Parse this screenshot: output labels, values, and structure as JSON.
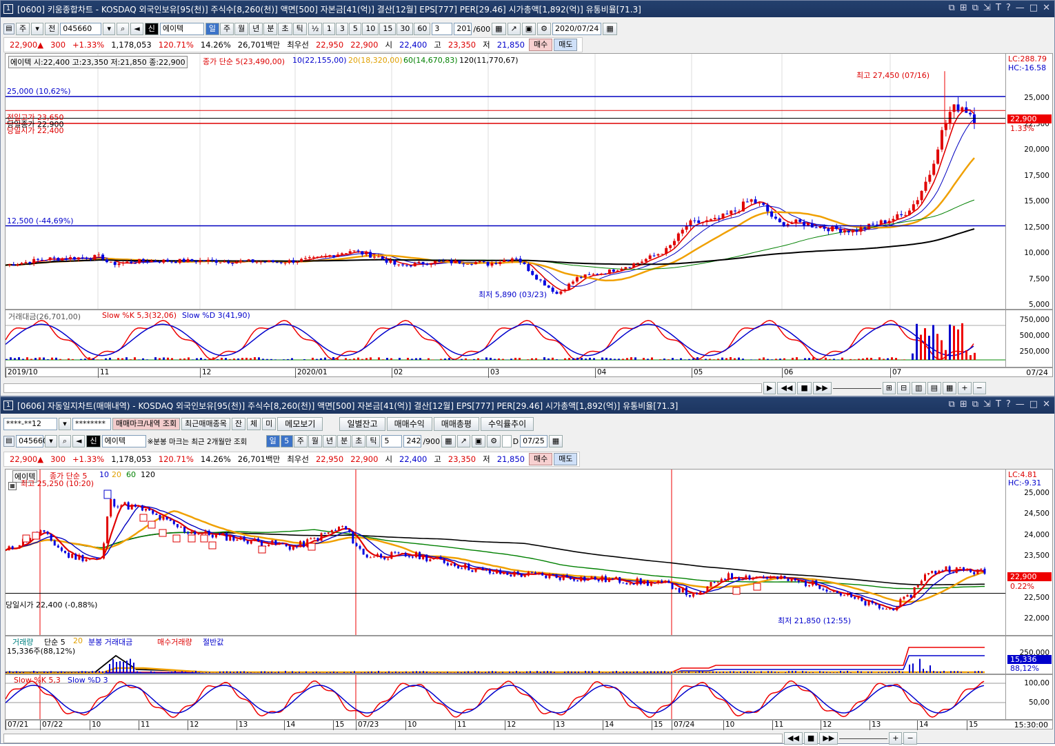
{
  "top": {
    "title": "[0600] 키움종합차트 - KOSDAQ 외국인보유[95(천)] 주식수[8,260(천)] 액면[500] 자본금[41(억)] 결산[12월] EPS[777] PER[29.46] 시가총액[1,892(억)] 유통비율[71.3]",
    "win_num": "1",
    "toolbar": {
      "code": "045660",
      "name": "에이텍",
      "period_tabs": [
        "일",
        "주",
        "월",
        "년",
        "분",
        "초",
        "틱"
      ],
      "halves": [
        "½",
        "1",
        "3",
        "5",
        "10",
        "15",
        "30",
        "60"
      ],
      "count": "3",
      "range": "201",
      "range_max": "/600",
      "date": "2020/07/24",
      "btn_ju": "주",
      "btn_jeon": "전",
      "btn_sin": "신"
    },
    "quote": {
      "price": "22,900▲",
      "change": "300",
      "rate": "+1.33%",
      "volume": "1,178,053",
      "vol_ratio": "120.71%",
      "turnover": "14.26%",
      "amount": "26,701백만",
      "best_label": "최우선",
      "best_ask": "22,950",
      "best_bid": "22,900",
      "open_label": "시",
      "open": "22,400",
      "high_label": "고",
      "high": "23,350",
      "low_label": "저",
      "low": "21,850",
      "buy": "매수",
      "sell": "매도"
    },
    "legend": {
      "ohlc": "에이텍 시:22,400 고:23,350 저:21,850 종:22,900",
      "ma_title": "종가 단순 5(23,490,00)",
      "ma10": "10(22,155,00)",
      "ma20": "20(18,320,00)",
      "ma60": "60(14,670,83)",
      "ma120": "120(11,770,67)"
    },
    "hlines": {
      "l25000": "25,000 (10,62%)",
      "l12500": "12,500 (-44,69%)",
      "prev_high": "전일고가 23,650",
      "today_close": "당일종가 22,900",
      "today_open": "당일시가 22,400"
    },
    "annotations": {
      "high": "최고 27,450 (07/16)",
      "low": "최저 5,890 (03/23)"
    },
    "lc": "LC:288.79",
    "hc": "HC:-16.58",
    "cur_price": "22,900",
    "cur_rate": "1.33%",
    "yticks": [
      "25,000",
      "22,500",
      "20,000",
      "17,500",
      "15,000",
      "12,500",
      "10,000",
      "7,500",
      "5,000"
    ],
    "sub_legend": {
      "amount": "거래대금(26,701,00)",
      "k": "Slow %K 5,3(32,06)",
      "d": "Slow %D 3(41,90)"
    },
    "sub_yticks": [
      "750,000",
      "500,000",
      "250,000"
    ],
    "xticks": [
      "2019/10",
      "11",
      "12",
      "2020/01",
      "02",
      "03",
      "04",
      "05",
      "06",
      "07"
    ],
    "x_end": "07/24"
  },
  "bottom": {
    "title": "[0606] 자동일지차트(매매내역) - KOSDAQ 외국인보유[95(천)] 주식수[8,260(천)] 액면[500] 자본금[41(억)] 결산[12월] EPS[777] PER[29.46] 시가총액[1,892(억)] 유통비율[71.3]",
    "win_num": "1",
    "account": "****-**12",
    "password": "********",
    "buttons": [
      "매매마크/내역 조회",
      "최근매매종목",
      "잔",
      "체",
      "미",
      "메모보기",
      "일별잔고",
      "매매수익",
      "매매총평",
      "수익률추이"
    ],
    "toolbar": {
      "code": "045660",
      "name": "에이텍",
      "note": "※분봉 마크는 최근 2개월만 조회",
      "period_tabs": [
        "일",
        "주",
        "월",
        "년",
        "분",
        "초",
        "틱"
      ],
      "active_num": "5",
      "count": "5",
      "range": "242",
      "range_max": "/900",
      "date": "07/25",
      "d_label": "D",
      "btn_sin": "신"
    },
    "quote": {
      "price": "22,900▲",
      "change": "300",
      "rate": "+1.33%",
      "volume": "1,178,053",
      "vol_ratio": "120.71%",
      "turnover": "14.26%",
      "amount": "26,701백만",
      "best_label": "최우선",
      "best_ask": "22,950",
      "best_bid": "22,900",
      "open_label": "시",
      "open": "22,400",
      "high_label": "고",
      "high": "23,350",
      "low_label": "저",
      "low": "21,850",
      "buy": "매수",
      "sell": "매도"
    },
    "legend": {
      "name": "에이텍",
      "ma_title": "종가 단순 5",
      "ma10": "10",
      "ma20": "20",
      "ma60": "60",
      "ma120": "120"
    },
    "annotations": {
      "high": "최고 25,250 (10:20)",
      "low": "최저 21,850 (12:55)",
      "today_open": "당일시가 22,400 (-0,88%)"
    },
    "lc": "LC:4.81",
    "hc": "HC:-9.31",
    "cur_price": "22,900",
    "cur_rate": "0.22%",
    "yticks": [
      "25,000",
      "24,500",
      "24,000",
      "23,500",
      "23,000",
      "22,500",
      "22,000"
    ],
    "vol_legend": {
      "vol": "거래량",
      "simple": "단순 5",
      "n20": "20",
      "min_amount": "분봉 거래대금",
      "buy_vol": "매수거래량",
      "half": "절반값",
      "sub": "15,336주(88,12%)"
    },
    "vol_yticks": [
      "250,000"
    ],
    "vol_box": "15,336",
    "vol_rate": "88,12%",
    "stoch_legend": {
      "k": "Slow %K 5,3",
      "d": "Slow %D 3"
    },
    "stoch_yticks": [
      "100,00",
      "50,00"
    ],
    "xticks": [
      "07/21",
      "07/22",
      "10",
      "11",
      "12",
      "13",
      "14",
      "15",
      "07/23",
      "10",
      "11",
      "12",
      "13",
      "14",
      "15",
      "07/24",
      "10",
      "11",
      "12",
      "13",
      "14",
      "15"
    ],
    "x_end": "15:30:00"
  },
  "colors": {
    "up": "#e00000",
    "down": "#0000e0",
    "ma5": "#e00000",
    "ma10": "#0000c0",
    "ma20": "#f0a000",
    "ma60": "#008000",
    "ma120": "#000000"
  }
}
